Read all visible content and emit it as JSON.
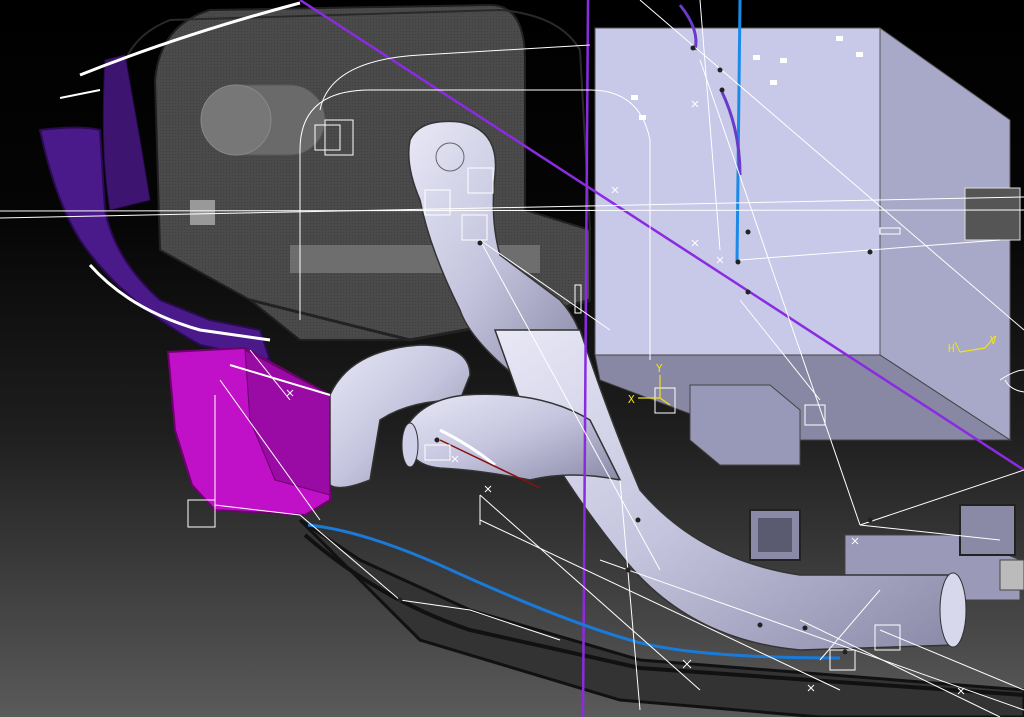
{
  "colors": {
    "background_top": "#000000",
    "background_bottom": "#5a5a5a",
    "duct_fill": "#c9c9e4",
    "box_fill": "#c8c8e8",
    "dark_shell": "#4a4a4a",
    "magenta_part": "#c010c8",
    "purple_part": "#4a1a8a",
    "purple_line": "#8a2be2",
    "blue_curve": "#1a7ad8",
    "wireframe": "#ffffff",
    "axis_yellow": "#f0e020"
  },
  "icons": [
    "compass-triad-icon",
    "axis-triad-icon"
  ],
  "compass": {
    "h": "H",
    "v": "V"
  },
  "axis": {
    "x": "X",
    "y": "Y"
  }
}
